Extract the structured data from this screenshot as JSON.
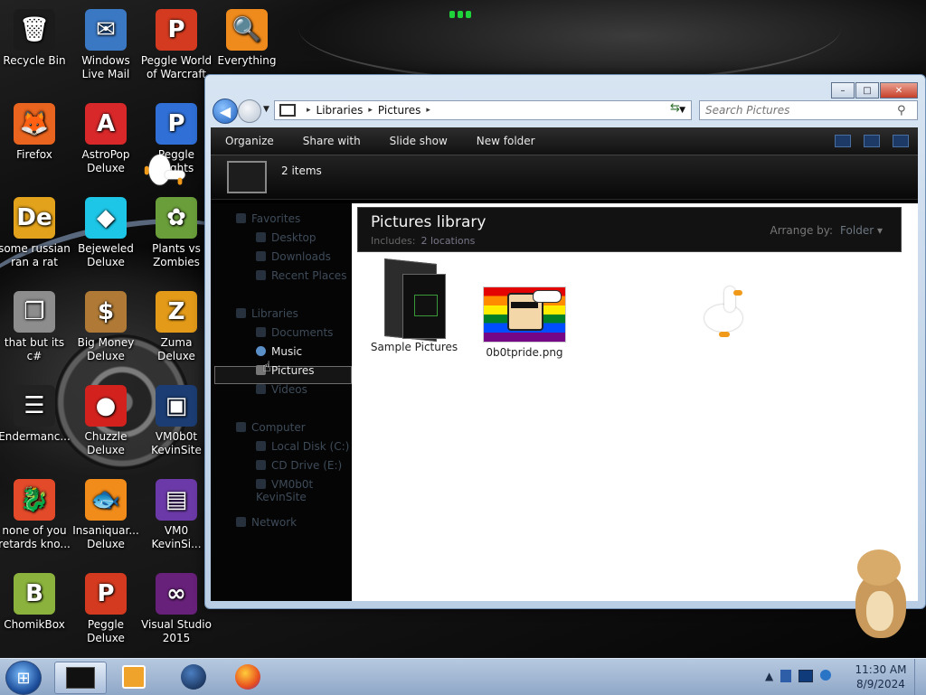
{
  "desktop": {
    "icons": [
      {
        "label": "Recycle Bin",
        "icon": "recycle-bin-icon",
        "glyph": "🗑",
        "color": "#1b1b1b"
      },
      {
        "label": "Windows Live Mail",
        "icon": "mail-icon",
        "glyph": "✉",
        "color": "#3a78c4"
      },
      {
        "label": "Peggle World of Warcraft",
        "icon": "peggle-icon",
        "glyph": "P",
        "color": "#d43a1f"
      },
      {
        "label": "Everything",
        "icon": "magnifier-icon",
        "glyph": "🔍",
        "color": "#ef8a1c"
      },
      {
        "label": "Firefox",
        "icon": "firefox-icon",
        "glyph": "🦊",
        "color": "#e8641f"
      },
      {
        "label": "AstroPop Deluxe",
        "icon": "astropop-icon",
        "glyph": "A",
        "color": "#d8282a"
      },
      {
        "label": "Peggle Nights",
        "icon": "peggle-nights-icon",
        "glyph": "P",
        "color": "#2f6fd6"
      },
      {
        "label": "some russian ran a rat",
        "icon": "de-icon",
        "glyph": "De",
        "color": "#e3a21b"
      },
      {
        "label": "Bejeweled Deluxe",
        "icon": "gem-icon",
        "glyph": "◆",
        "color": "#1dc5e6"
      },
      {
        "label": "Plants vs Zombies",
        "icon": "plant-icon",
        "glyph": "✿",
        "color": "#6a9e3a"
      },
      {
        "label": "that but its c#",
        "icon": "stack-icon",
        "glyph": "❐",
        "color": "#8d8d8d"
      },
      {
        "label": "Big Money Deluxe",
        "icon": "money-bag-icon",
        "glyph": "$",
        "color": "#b07a36"
      },
      {
        "label": "Zuma Deluxe",
        "icon": "zuma-icon",
        "glyph": "Z",
        "color": "#e39a18"
      },
      {
        "label": "Endermanc...",
        "icon": "list-icon",
        "glyph": "☰",
        "color": "#222"
      },
      {
        "label": "Chuzzle Deluxe",
        "icon": "chuzzle-icon",
        "glyph": "●",
        "color": "#d3221e"
      },
      {
        "label": "VM0b0t KevinSite",
        "icon": "vm-icon",
        "glyph": "▣",
        "color": "#1b3d73"
      },
      {
        "label": "none of you retards kno...",
        "icon": "dragon-icon",
        "glyph": "🐉",
        "color": "#e24a2a"
      },
      {
        "label": "Insaniquar... Deluxe",
        "icon": "fish-icon",
        "glyph": "🐟",
        "color": "#f18b1a"
      },
      {
        "label": "VM0 KevinSi...",
        "icon": "firefox-file-icon",
        "glyph": "▤",
        "color": "#6c3aa8"
      },
      {
        "label": "ChomikBox",
        "icon": "hamster-box-icon",
        "glyph": "B",
        "color": "#8ab23c"
      },
      {
        "label": "Peggle Deluxe",
        "icon": "peggle-deluxe-icon",
        "glyph": "P",
        "color": "#d43a1f"
      },
      {
        "label": "Visual Studio 2015",
        "icon": "visual-studio-icon",
        "glyph": "∞",
        "color": "#68217a"
      }
    ]
  },
  "window": {
    "buttons": {
      "minimize": "–",
      "maximize": "□",
      "close": "✕"
    },
    "address": {
      "crumbs": [
        "Libraries",
        "Pictures"
      ],
      "sep": "▸"
    },
    "search": {
      "placeholder": "Search Pictures"
    },
    "toolbar": {
      "organize": "Organize",
      "share": "Share with",
      "slideshow": "Slide show",
      "newfolder": "New folder"
    },
    "details": {
      "count": "2 items"
    },
    "nav": {
      "favorites": "Favorites",
      "desktop": "Desktop",
      "downloads": "Downloads",
      "recent": "Recent Places",
      "libraries": "Libraries",
      "documents": "Documents",
      "music": "Music",
      "pictures": "Pictures",
      "videos": "Videos",
      "computer": "Computer",
      "localdisk": "Local Disk (C:)",
      "cddrive": "CD Drive (E:)",
      "vmsite": "VM0b0t KevinSite",
      "network": "Network"
    },
    "library": {
      "title": "Pictures library",
      "includes_label": "Includes:",
      "includes_value": "2 locations",
      "arrange_label": "Arrange by:",
      "arrange_value": "Folder"
    },
    "files": {
      "folder": "Sample Pictures",
      "image": "0b0tpride.png"
    }
  },
  "taskbar": {
    "start_glyph": "⊞",
    "clock_time": "11:30 AM",
    "clock_date": "8/9/2024",
    "tray_arrow": "▲"
  }
}
